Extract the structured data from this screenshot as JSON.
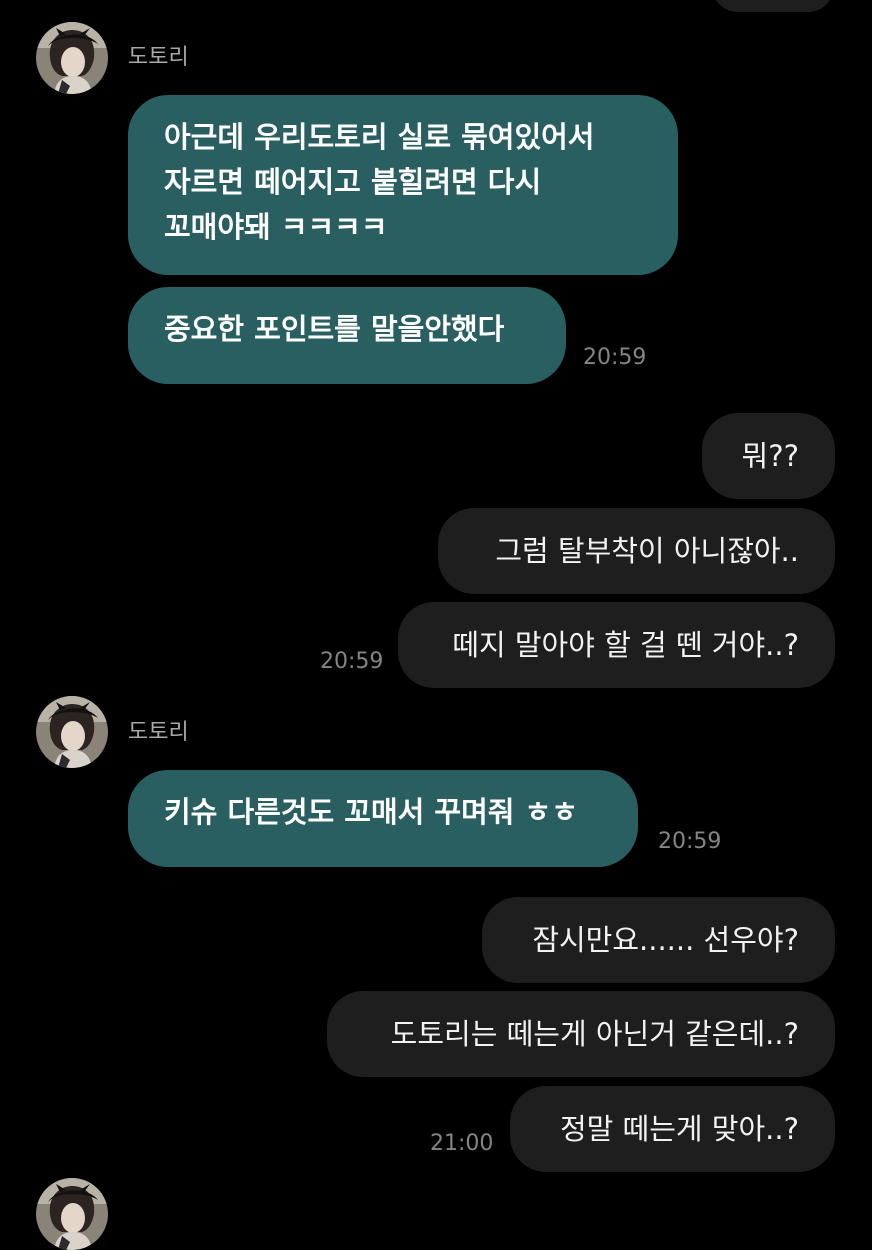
{
  "chat": {
    "sender_name": "도토리",
    "groups": [
      {
        "sender": "도토리",
        "messages": [
          {
            "lines": [
              "아근데 우리도토리 실로 묶여있어서",
              "자르면 떼어지고 붙힐려면 다시",
              "꼬매야돼 ㅋㅋㅋㅋ"
            ]
          },
          {
            "lines": [
              "중요한 포인트를 말을안했다"
            ]
          }
        ],
        "time": "20:59"
      },
      {
        "sender": "me",
        "messages": [
          {
            "text": "뭐??"
          },
          {
            "text": "그럼 탈부착이 아니잖아.."
          },
          {
            "text": "떼지 말아야 할 걸 뗀 거야..?"
          }
        ],
        "time": "20:59"
      },
      {
        "sender": "도토리",
        "messages": [
          {
            "lines": [
              "키슈 다른것도 꼬매서 꾸며줘 ㅎㅎ"
            ]
          }
        ],
        "time": "20:59"
      },
      {
        "sender": "me",
        "messages": [
          {
            "text": "잠시만요...... 선우야?"
          },
          {
            "text": "도토리는 떼는게 아닌거 같은데..?"
          },
          {
            "text": "정말 떼는게 맞아..?"
          }
        ],
        "time": "21:00"
      }
    ]
  },
  "colors": {
    "background": "#000000",
    "incoming_bubble": "#2a5f62",
    "outgoing_bubble": "#1e1e1e",
    "timestamp": "#858585",
    "sender_name": "#a9a9a9"
  }
}
